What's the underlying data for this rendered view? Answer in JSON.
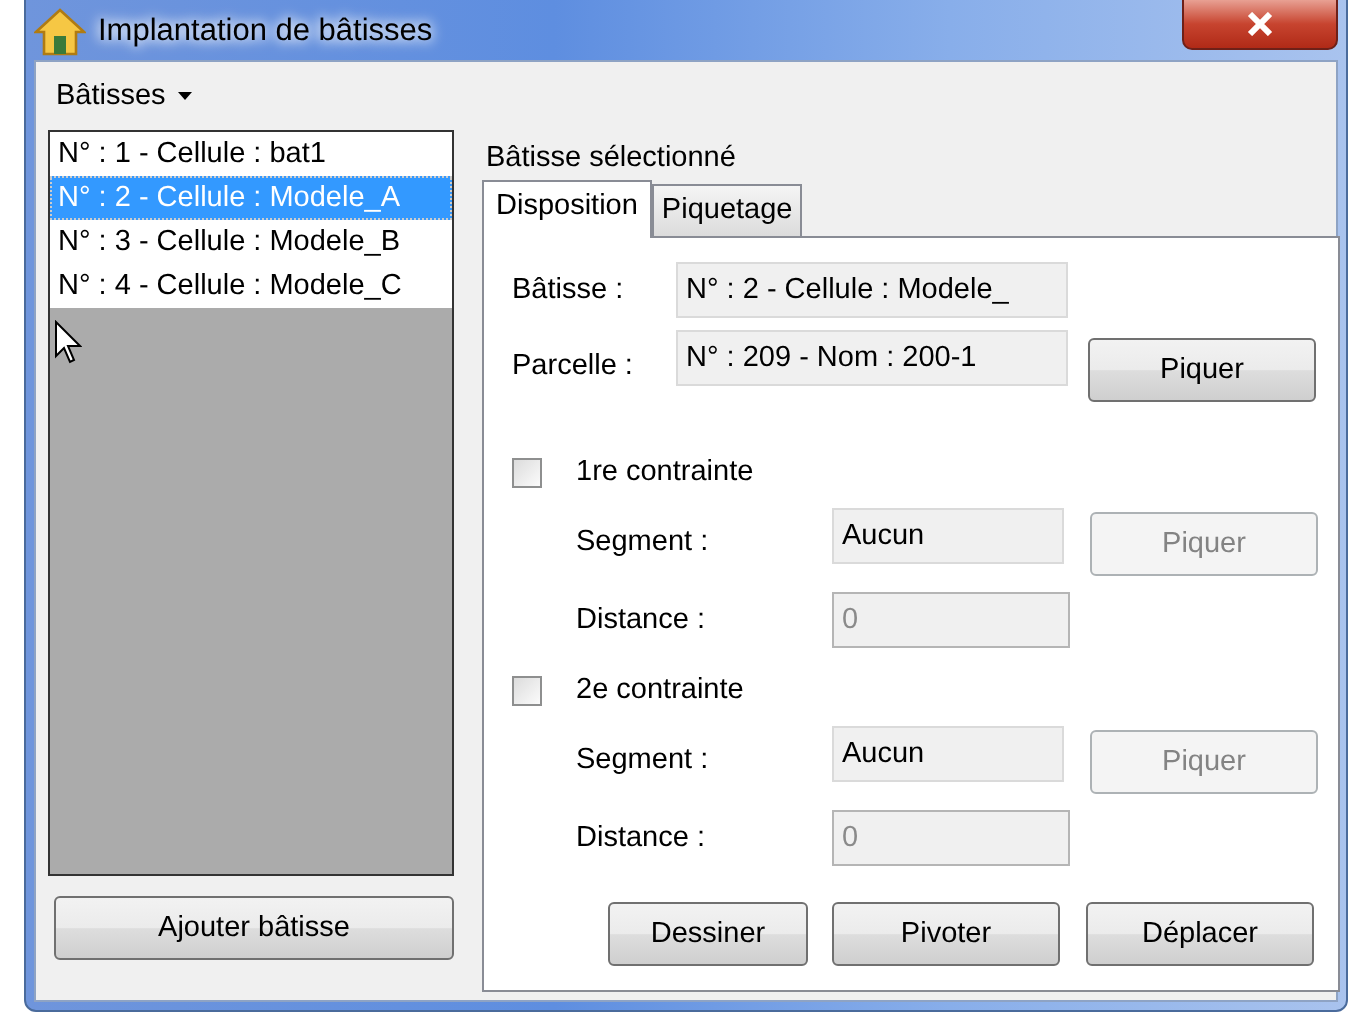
{
  "window": {
    "title": "Implantation de bâtisses"
  },
  "menu": {
    "label": "Bâtisses"
  },
  "buildings": [
    {
      "label": "N° : 1 - Cellule : bat1",
      "selected": false
    },
    {
      "label": "N° : 2 - Cellule : Modele_A",
      "selected": true
    },
    {
      "label": "N° : 3 - Cellule : Modele_B",
      "selected": false
    },
    {
      "label": "N° : 4 - Cellule : Modele_C",
      "selected": false
    }
  ],
  "add_button": "Ajouter bâtisse",
  "section_label": "Bâtisse sélectionné",
  "tabs": [
    {
      "label": "Disposition",
      "selected": true
    },
    {
      "label": "Piquetage",
      "selected": false
    }
  ],
  "fields": [
    {
      "label": "Bâtisse :",
      "value": "N° : 2 - Cellule : Modele_"
    },
    {
      "label": "Parcelle :",
      "value": "N° : 209 - Nom : 200-1",
      "button": "Piquer"
    }
  ],
  "constraints": [
    {
      "label": "1re contrainte",
      "checked": false,
      "segment_label": "Segment :",
      "segment": "Aucun",
      "pick_button": "Piquer",
      "pick_disabled": true,
      "distance_label": "Distance :",
      "distance": "0",
      "distance_disabled": true
    },
    {
      "label": "2e contrainte",
      "checked": false,
      "segment_label": "Segment :",
      "segment": "Aucun",
      "pick_button": "Piquer",
      "pick_disabled": true,
      "distance_label": "Distance :",
      "distance": "0",
      "distance_disabled": true
    }
  ],
  "actions": [
    "Dessiner",
    "Pivoter",
    "Déplacer"
  ]
}
